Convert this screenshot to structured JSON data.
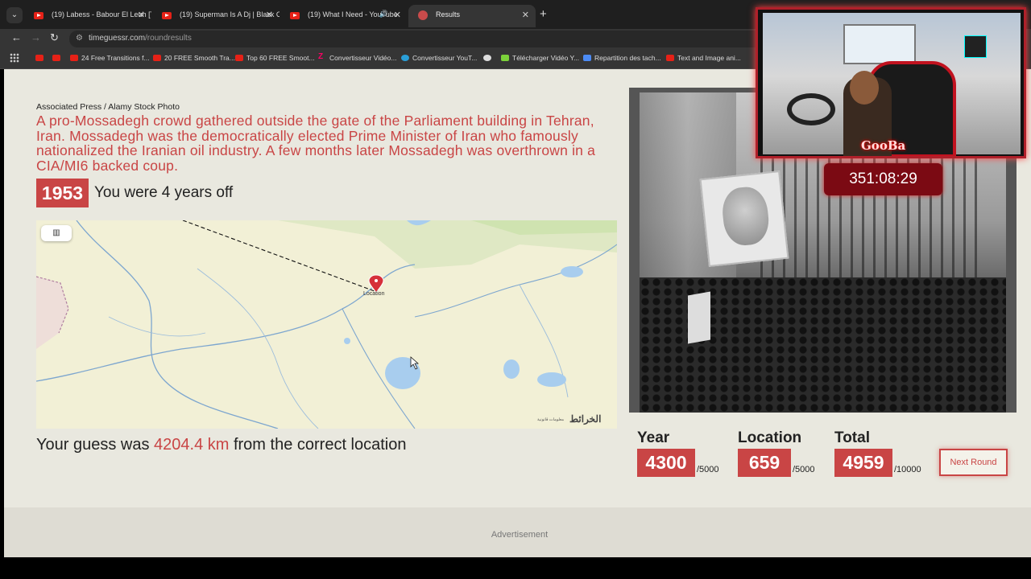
{
  "browser": {
    "tabs": [
      {
        "title": "(19) Labess - Babour El Leuh [T",
        "icon": "youtube-icon"
      },
      {
        "title": "(19) Superman Is A Dj | Black C",
        "icon": "youtube-icon"
      },
      {
        "title": "(19) What I Need - YouTube",
        "icon": "youtube-icon"
      },
      {
        "title": "Results",
        "icon": "site-icon"
      }
    ],
    "url_domain": "timeguessr.com",
    "url_path": "/roundresults",
    "bookmarks": [
      {
        "label": "",
        "icon": "youtube-icon"
      },
      {
        "label": "",
        "icon": "youtube-icon"
      },
      {
        "label": "24 Free Transitions f...",
        "icon": "youtube-icon"
      },
      {
        "label": "20 FREE Smooth Tra...",
        "icon": "youtube-icon"
      },
      {
        "label": "Top 60 FREE Smoot...",
        "icon": "youtube-icon"
      },
      {
        "label": "Convertisseur Vidéo...",
        "icon": "z-icon"
      },
      {
        "label": "Convertisseur YouT...",
        "icon": "globe-icon"
      },
      {
        "label": "",
        "icon": "world-icon"
      },
      {
        "label": "Télécharger Vidéo Y...",
        "icon": "download-icon"
      },
      {
        "label": "Repartition des tach...",
        "icon": "doc-icon"
      },
      {
        "label": "Text and Image ani...",
        "icon": "youtube-icon"
      }
    ]
  },
  "round": {
    "source": "Associated Press / Alamy Stock Photo",
    "description": "A pro-Mossadegh crowd gathered outside the gate of the Parliament building in Tehran, Iran. Mossadegh was the democratically elected Prime Minister of Iran who famously nationalized the Iranian oil industry. A few months later Mossadegh was overthrown in a CIA/MI6 backed coup.",
    "year": "1953",
    "years_off": "You were 4 years off",
    "map_pin_label": "Location",
    "map_logo": "الخرائط",
    "map_credit": "معلومات قانونية",
    "guess_prefix": "Your guess was ",
    "guess_distance": "4204.4 km",
    "guess_suffix": " from the correct location"
  },
  "overlay": {
    "streamer_name": "GooBa",
    "timer": "351:08:29"
  },
  "scores": {
    "year_label": "Year",
    "year_score": "4300",
    "year_max": "/5000",
    "location_label": "Location",
    "location_score": "659",
    "location_max": "/5000",
    "total_label": "Total",
    "total_score": "4959",
    "total_max": "/10000",
    "next_button": "Next Round"
  },
  "ad_label": "Advertisement",
  "colors": {
    "accent": "#c94545",
    "background": "#e9e8df"
  }
}
